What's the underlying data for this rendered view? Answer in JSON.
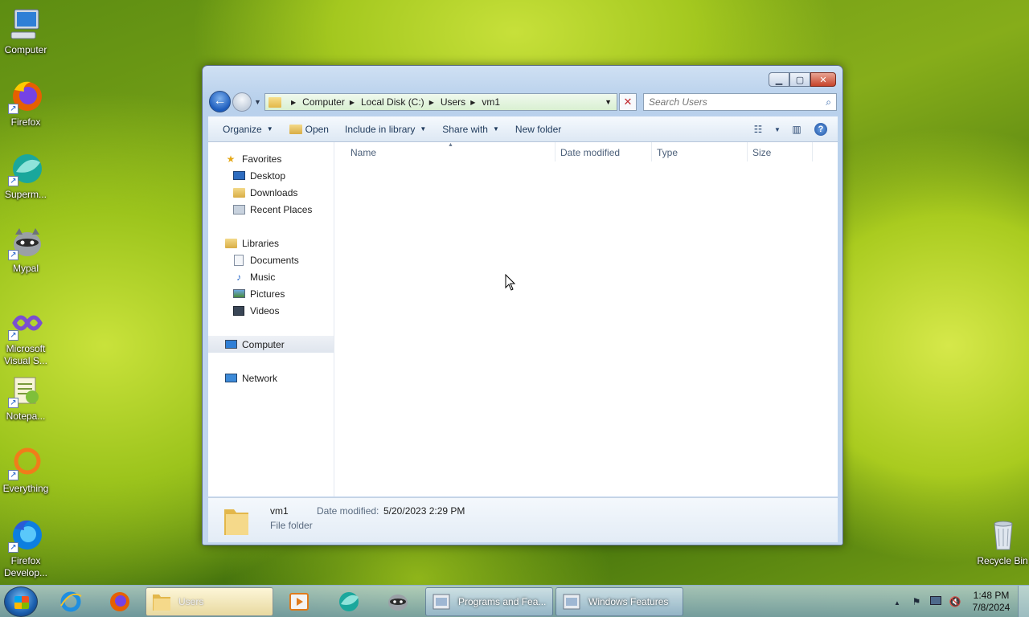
{
  "desktop": {
    "icons": [
      {
        "label": "Computer",
        "icon": "computer-icon"
      },
      {
        "label": "Firefox",
        "icon": "firefox-icon"
      },
      {
        "label": "Superm...",
        "icon": "supermium-icon"
      },
      {
        "label": "Mypal",
        "icon": "mypal-icon"
      },
      {
        "label": "Microsoft\nVisual S...",
        "icon": "visual-studio-icon"
      },
      {
        "label": "Notepa...",
        "icon": "notepad-plus-plus-icon"
      },
      {
        "label": "Everything",
        "icon": "everything-icon"
      },
      {
        "label": "Firefox\nDevelop...",
        "icon": "firefox-developer-icon"
      }
    ],
    "recycle_bin": "Recycle Bin"
  },
  "explorer": {
    "address": {
      "crumbs": [
        "Computer",
        "Local Disk (C:)",
        "Users",
        "vm1"
      ]
    },
    "search": {
      "placeholder": "Search Users"
    },
    "toolbar": {
      "organize": "Organize",
      "open": "Open",
      "include_in_library": "Include in library",
      "share_with": "Share with",
      "new_folder": "New folder"
    },
    "nav": {
      "favorites": "Favorites",
      "desktop": "Desktop",
      "downloads": "Downloads",
      "recent_places": "Recent Places",
      "libraries": "Libraries",
      "documents": "Documents",
      "music": "Music",
      "pictures": "Pictures",
      "videos": "Videos",
      "computer": "Computer",
      "network": "Network"
    },
    "columns": {
      "name": "Name",
      "date_modified": "Date modified",
      "type": "Type",
      "size": "Size"
    },
    "details": {
      "name": "vm1",
      "type": "File folder",
      "date_label": "Date modified:",
      "date_value": "5/20/2023 2:29 PM"
    }
  },
  "taskbar": {
    "tasks": {
      "users": "Users",
      "programs": "Programs and Fea...",
      "features": "Windows Features"
    },
    "clock": {
      "time": "1:48 PM",
      "date": "7/8/2024"
    }
  }
}
